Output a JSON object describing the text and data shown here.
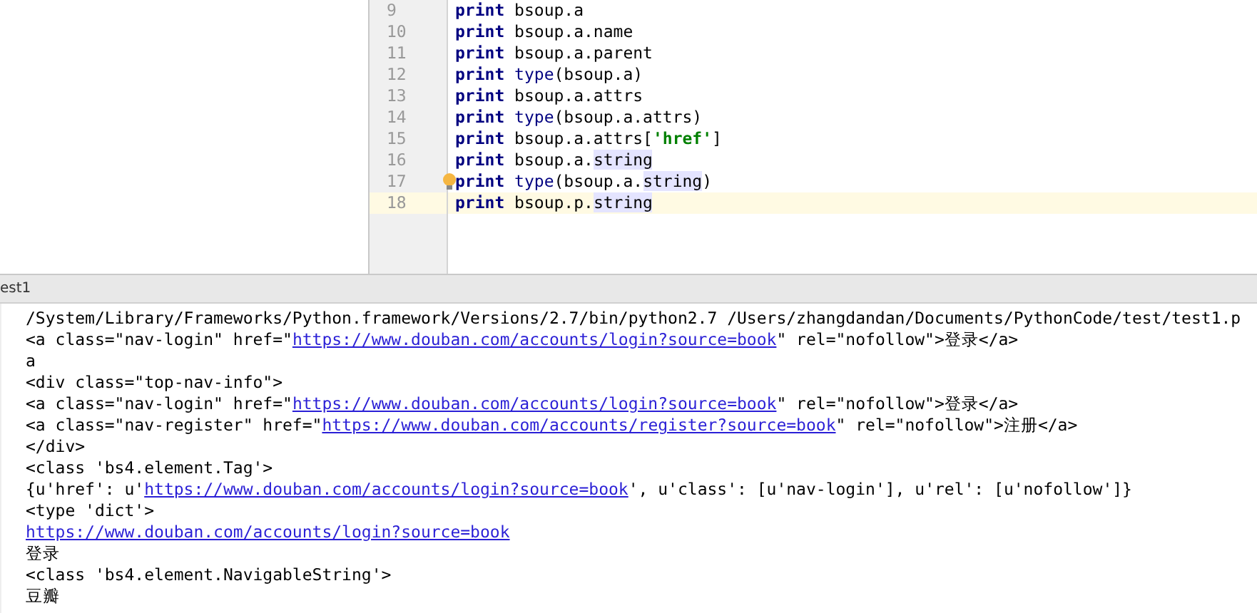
{
  "editor": {
    "lines": [
      {
        "number": "9",
        "current": false,
        "bulb": false,
        "tokens": [
          {
            "kind": "keyword",
            "text": "print"
          },
          {
            "kind": "plain",
            "text": " bsoup.a"
          }
        ]
      },
      {
        "number": "10",
        "current": false,
        "bulb": false,
        "tokens": [
          {
            "kind": "keyword",
            "text": "print"
          },
          {
            "kind": "plain",
            "text": " bsoup.a.name"
          }
        ]
      },
      {
        "number": "11",
        "current": false,
        "bulb": false,
        "tokens": [
          {
            "kind": "keyword",
            "text": "print"
          },
          {
            "kind": "plain",
            "text": " bsoup.a.parent"
          }
        ]
      },
      {
        "number": "12",
        "current": false,
        "bulb": false,
        "tokens": [
          {
            "kind": "keyword",
            "text": "print"
          },
          {
            "kind": "builtin",
            "text": " type"
          },
          {
            "kind": "plain",
            "text": "(bsoup.a)"
          }
        ]
      },
      {
        "number": "13",
        "current": false,
        "bulb": false,
        "tokens": [
          {
            "kind": "keyword",
            "text": "print"
          },
          {
            "kind": "plain",
            "text": " bsoup.a.attrs"
          }
        ]
      },
      {
        "number": "14",
        "current": false,
        "bulb": false,
        "tokens": [
          {
            "kind": "keyword",
            "text": "print"
          },
          {
            "kind": "builtin",
            "text": " type"
          },
          {
            "kind": "plain",
            "text": "(bsoup.a.attrs)"
          }
        ]
      },
      {
        "number": "15",
        "current": false,
        "bulb": false,
        "tokens": [
          {
            "kind": "keyword",
            "text": "print"
          },
          {
            "kind": "plain",
            "text": " bsoup.a.attrs["
          },
          {
            "kind": "string",
            "text": "'href'"
          },
          {
            "kind": "plain",
            "text": "]"
          }
        ]
      },
      {
        "number": "16",
        "current": false,
        "bulb": false,
        "tokens": [
          {
            "kind": "keyword",
            "text": "print"
          },
          {
            "kind": "plain",
            "text": " bsoup.a."
          },
          {
            "kind": "match",
            "text": "string"
          }
        ]
      },
      {
        "number": "17",
        "current": false,
        "bulb": true,
        "tokens": [
          {
            "kind": "keyword",
            "text": "print"
          },
          {
            "kind": "builtin",
            "text": " type"
          },
          {
            "kind": "plain",
            "text": "(bsoup.a."
          },
          {
            "kind": "match",
            "text": "string"
          },
          {
            "kind": "plain",
            "text": ")"
          }
        ]
      },
      {
        "number": "18",
        "current": true,
        "bulb": false,
        "tokens": [
          {
            "kind": "keyword",
            "text": "print"
          },
          {
            "kind": "plain",
            "text": " bsoup.p."
          },
          {
            "kind": "match",
            "text": "string"
          }
        ]
      }
    ]
  },
  "run_tab": {
    "label": "est1"
  },
  "console": {
    "lines": [
      [
        {
          "text": "/System/Library/Frameworks/Python.framework/Versions/2.7/bin/python2.7 /Users/zhangdandan/Documents/PythonCode/test/test1.p",
          "link": false
        }
      ],
      [
        {
          "text": "<a class=\"nav-login\" href=\"",
          "link": false
        },
        {
          "text": "https://www.douban.com/accounts/login?source=book",
          "link": true
        },
        {
          "text": "\" rel=\"nofollow\">登录</a>",
          "link": false
        }
      ],
      [
        {
          "text": "a",
          "link": false
        }
      ],
      [
        {
          "text": "<div class=\"top-nav-info\">",
          "link": false
        }
      ],
      [
        {
          "text": "<a class=\"nav-login\" href=\"",
          "link": false
        },
        {
          "text": "https://www.douban.com/accounts/login?source=book",
          "link": true
        },
        {
          "text": "\" rel=\"nofollow\">登录</a>",
          "link": false
        }
      ],
      [
        {
          "text": "<a class=\"nav-register\" href=\"",
          "link": false
        },
        {
          "text": "https://www.douban.com/accounts/register?source=book",
          "link": true
        },
        {
          "text": "\" rel=\"nofollow\">注册</a>",
          "link": false
        }
      ],
      [
        {
          "text": "</div>",
          "link": false
        }
      ],
      [
        {
          "text": "<class 'bs4.element.Tag'>",
          "link": false
        }
      ],
      [
        {
          "text": "{u'href': u'",
          "link": false
        },
        {
          "text": "https://www.douban.com/accounts/login?source=book",
          "link": true
        },
        {
          "text": "', u'class': [u'nav-login'], u'rel': [u'nofollow']}",
          "link": false
        }
      ],
      [
        {
          "text": "<type 'dict'>",
          "link": false
        }
      ],
      [
        {
          "text": "https://www.douban.com/accounts/login?source=book",
          "link": true
        }
      ],
      [
        {
          "text": "登录",
          "link": false
        }
      ],
      [
        {
          "text": "<class 'bs4.element.NavigableString'>",
          "link": false
        }
      ],
      [
        {
          "text": "豆瓣",
          "link": false
        }
      ]
    ]
  }
}
